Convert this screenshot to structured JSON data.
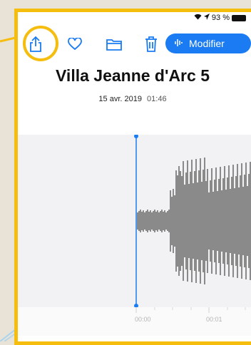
{
  "status_bar": {
    "battery_percent": "93 %"
  },
  "toolbar": {
    "share_icon": "share-icon",
    "favorite_icon": "heart-icon",
    "folder_icon": "folder-icon",
    "trash_icon": "trash-icon",
    "modify_label": "Modifier"
  },
  "recording": {
    "title": "Villa Jeanne d'Arc 5",
    "date": "15 avr. 2019",
    "time": "01:46"
  },
  "timeline": {
    "ticks": [
      "00:00",
      "00:01"
    ]
  },
  "colors": {
    "accent": "#1a7bf2",
    "highlight": "#f5bd0e"
  }
}
